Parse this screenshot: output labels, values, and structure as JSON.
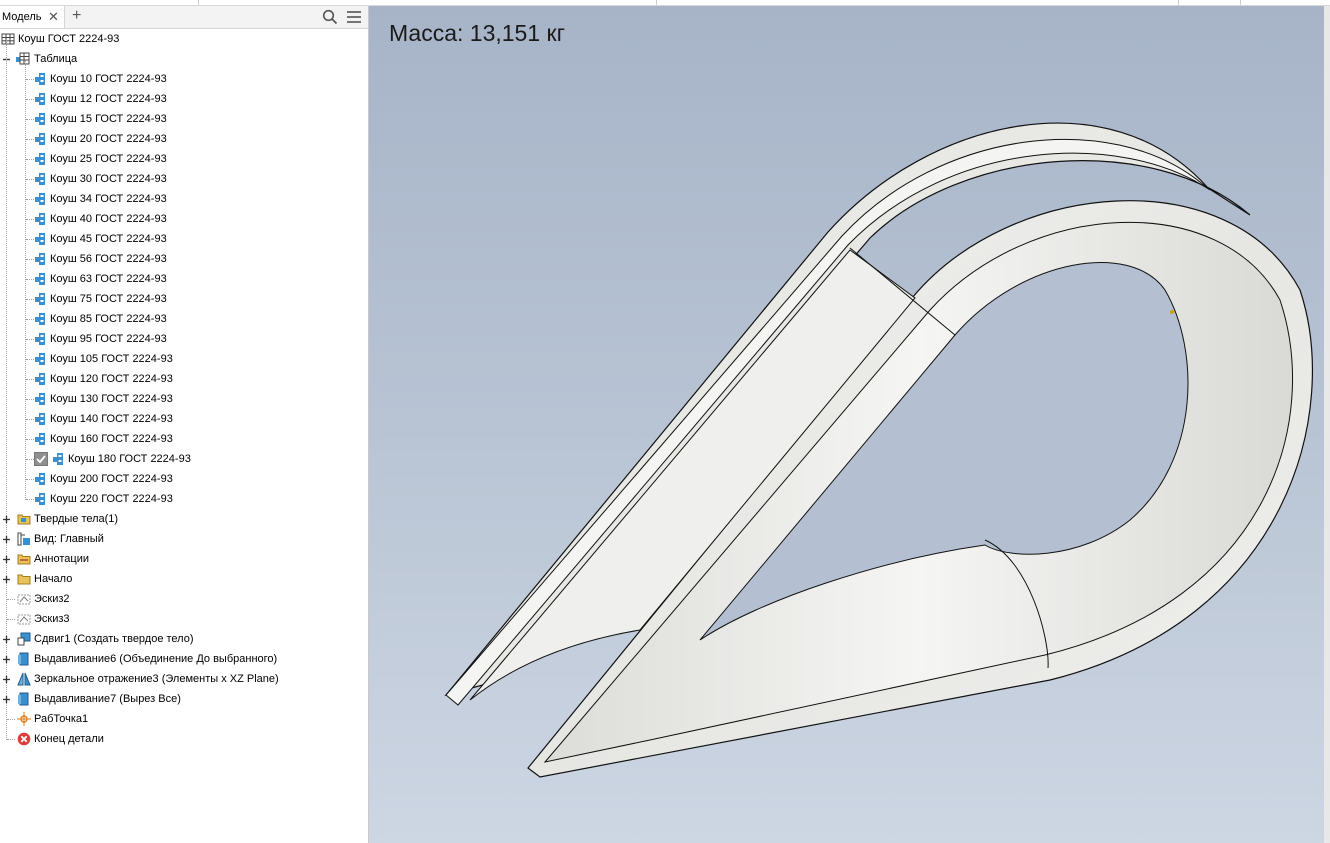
{
  "panel": {
    "tab_label": "Модель",
    "tab_close": "✕",
    "tab_add": "+"
  },
  "tree": {
    "root": "Коуш ГОСТ 2224-93",
    "table": "Таблица",
    "variants": [
      "Коуш 10 ГОСТ 2224-93",
      "Коуш 12 ГОСТ 2224-93",
      "Коуш 15 ГОСТ 2224-93",
      "Коуш 20 ГОСТ 2224-93",
      "Коуш 25 ГОСТ 2224-93",
      "Коуш 30 ГОСТ 2224-93",
      "Коуш 34 ГОСТ 2224-93",
      "Коуш 40 ГОСТ 2224-93",
      "Коуш 45 ГОСТ 2224-93",
      "Коуш 56 ГОСТ 2224-93",
      "Коуш 63 ГОСТ 2224-93",
      "Коуш 75 ГОСТ 2224-93",
      "Коуш 85 ГОСТ 2224-93",
      "Коуш 95 ГОСТ 2224-93",
      "Коуш 105 ГОСТ 2224-93",
      "Коуш 120 ГОСТ 2224-93",
      "Коуш 130 ГОСТ 2224-93",
      "Коуш 140 ГОСТ 2224-93",
      "Коуш 160 ГОСТ 2224-93",
      "Коуш 180 ГОСТ 2224-93",
      "Коуш 200 ГОСТ 2224-93",
      "Коуш 220 ГОСТ 2224-93"
    ],
    "active_variant": "Коуш 180 ГОСТ 2224-93",
    "features": [
      {
        "label": "Твердые тела(1)",
        "icon": "folder-bodies-icon",
        "expandable": true
      },
      {
        "label": "Вид: Главный",
        "icon": "view-icon",
        "expandable": true
      },
      {
        "label": "Аннотации",
        "icon": "annotations-folder-icon",
        "expandable": true
      },
      {
        "label": "Начало",
        "icon": "origin-folder-icon",
        "expandable": true
      },
      {
        "label": "Эскиз2",
        "icon": "sketch-icon",
        "expandable": false
      },
      {
        "label": "Эскиз3",
        "icon": "sketch-icon",
        "expandable": false
      },
      {
        "label": "Сдвиг1 (Создать твердое тело)",
        "icon": "sweep-icon",
        "expandable": true
      },
      {
        "label": "Выдавливание6 (Объединение До выбранного)",
        "icon": "extrude-icon",
        "expandable": true
      },
      {
        "label": "Зеркальное отражение3 (Элементы x XZ Plane)",
        "icon": "mirror-icon",
        "expandable": true
      },
      {
        "label": "Выдавливание7 (Вырез Все)",
        "icon": "extrude-icon",
        "expandable": true
      },
      {
        "label": "РабТочка1",
        "icon": "workpoint-icon",
        "expandable": false
      },
      {
        "label": "Конец детали",
        "icon": "end-of-part-icon",
        "expandable": false
      }
    ]
  },
  "viewport": {
    "mass_label": "Масса: 13,151 кг"
  },
  "colors": {
    "viewport_top": "#a7b4c8",
    "viewport_bottom": "#cdd6e3",
    "part_face": "#ededeb",
    "variant_icon": "#3a8fd0",
    "end_of_part": "#e03a3a"
  }
}
